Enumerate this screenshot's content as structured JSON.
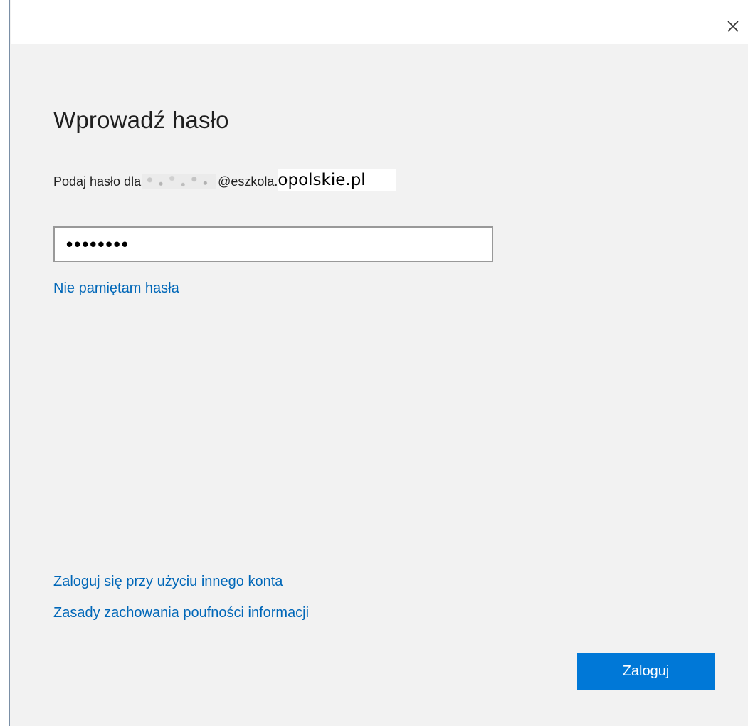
{
  "dialog": {
    "close_icon": "close-icon",
    "heading": "Wprowadź hasło",
    "subtitle_prefix": "Podaj hasło dla",
    "subtitle_email_domain": "@eszkola.",
    "subtitle_domain_overlay": "opolskie.pl",
    "password_value": "••••••••",
    "forgot_password_link": "Nie pamiętam hasła",
    "other_account_link": "Zaloguj się przy użyciu innego konta",
    "privacy_link": "Zasady zachowania poufności informacji",
    "sign_in_button": "Zaloguj"
  },
  "colors": {
    "accent": "#0078d7",
    "link": "#0067b8",
    "background": "#f2f2f2"
  }
}
